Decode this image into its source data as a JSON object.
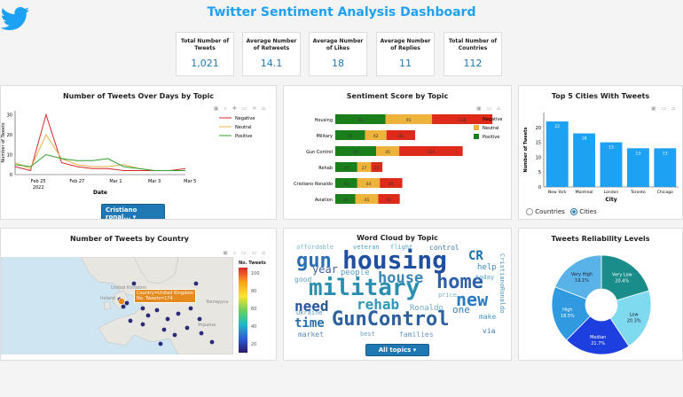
{
  "header": {
    "title": "Twitter Sentiment Analysis Dashboard",
    "logo_icon": "twitter-bird-icon",
    "brand_color": "#1da1f2"
  },
  "kpis": [
    {
      "label": "Total Number of Tweets",
      "value": "1,021"
    },
    {
      "label": "Average Number of Retweets",
      "value": "14.1"
    },
    {
      "label": "Average Number of Likes",
      "value": "18"
    },
    {
      "label": "Average Number of Replies",
      "value": "11"
    },
    {
      "label": "Total Number of Countries",
      "value": "112"
    }
  ],
  "line_panel": {
    "title": "Number of Tweets Over Days by Topic",
    "dropdown": "Cristiano ronal...",
    "chart_data": {
      "type": "line",
      "xlabel": "Date",
      "ylabel": "Number of Tweets",
      "x_ticks": [
        "Feb 25\n2022",
        "Feb 27",
        "Mar 1",
        "Mar 3",
        "Mar 5"
      ],
      "y_ticks": [
        "0",
        "10",
        "20",
        "30"
      ],
      "ylim": [
        0,
        32
      ],
      "x": [
        0,
        1,
        2,
        3,
        4,
        5,
        6,
        7,
        8,
        9,
        10,
        11
      ],
      "series": [
        {
          "name": "Negative",
          "color": "#d62728",
          "values": [
            4,
            2,
            30,
            6,
            4,
            3,
            3,
            2,
            2,
            2,
            2,
            3
          ]
        },
        {
          "name": "Neutral",
          "color": "#e4b04a",
          "values": [
            6,
            3,
            20,
            8,
            5,
            4,
            4,
            5,
            3,
            2,
            2,
            2
          ]
        },
        {
          "name": "Positive",
          "color": "#2ca02c",
          "values": [
            5,
            4,
            10,
            8,
            7,
            7,
            8,
            4,
            3,
            2,
            2,
            2
          ]
        }
      ]
    }
  },
  "sent_panel": {
    "title": "Sentiment Score by Topic",
    "chart_data": {
      "type": "bar",
      "orientation": "horizontal",
      "stacked": true,
      "categories": [
        "Housing",
        "Military",
        "Gun Control",
        "Rehab",
        "Cristiano Ronaldo",
        "Aviation"
      ],
      "series": [
        {
          "name": "Positive",
          "color": "#1a7f1a",
          "values": [
            98,
            58,
            80,
            43,
            43,
            39
          ]
        },
        {
          "name": "Neutral",
          "color": "#eeb33b",
          "values": [
            91,
            42,
            45,
            27,
            44,
            45
          ]
        },
        {
          "name": "Negative",
          "color": "#dd2a1a",
          "values": [
            118,
            56,
            124,
            22,
            44,
            42
          ]
        }
      ]
    }
  },
  "cities_panel": {
    "title": "Top 5 Cities With Tweets",
    "radio_options": [
      "Countries",
      "Cities"
    ],
    "radio_selected": "Cities",
    "chart_data": {
      "type": "bar",
      "categories": [
        "New York",
        "Montreal",
        "London",
        "Toronto",
        "Chicago"
      ],
      "values": [
        22,
        18,
        15,
        13,
        13
      ],
      "xlabel": "City",
      "ylabel": "Number of Tweets",
      "y_ticks": [
        "0",
        "5",
        "10",
        "15",
        "20"
      ],
      "ylim": [
        0,
        25
      ],
      "color": "#1da1f2"
    }
  },
  "map_panel": {
    "title": "Number of Tweets by Country",
    "colorbar_title": "No. Tweets",
    "colorbar_ticks": [
      "100",
      "80",
      "60",
      "40",
      "20"
    ],
    "tooltip_line1": "Country=United Kingdom",
    "tooltip_line2": "No. Tweets=174",
    "place_labels": [
      "United Kingdom",
      "Беларусь",
      "Україна",
      "Ireland"
    ]
  },
  "cloud_panel": {
    "title": "Word Cloud by Topic",
    "dropdown": "All topics",
    "words": [
      {
        "t": "gun",
        "c": "#2c6fb3"
      },
      {
        "t": "housing",
        "c": "#1f4f9e"
      },
      {
        "t": "military",
        "c": "#2a8fb0"
      },
      {
        "t": "home",
        "c": "#2e5fa8"
      },
      {
        "t": "GunControl",
        "c": "#2b5f9e"
      },
      {
        "t": "new",
        "c": "#2a7cc0"
      },
      {
        "t": "house",
        "c": "#3a87b5"
      },
      {
        "t": "need",
        "c": "#29579b"
      },
      {
        "t": "rehab",
        "c": "#3197b8"
      },
      {
        "t": "time",
        "c": "#2a6db0"
      },
      {
        "t": "CR",
        "c": "#1f6fa7"
      },
      {
        "t": "year",
        "c": "#3a5d9c"
      },
      {
        "t": "veteran",
        "c": "#4a9fc0"
      },
      {
        "t": "flight",
        "c": "#5aa8c8"
      },
      {
        "t": "control",
        "c": "#3f79a8"
      },
      {
        "t": "people",
        "c": "#55a0c8"
      },
      {
        "t": "help",
        "c": "#3b8ab9"
      },
      {
        "t": "Ronaldo",
        "c": "#6baac8"
      },
      {
        "t": "one",
        "c": "#397eb0"
      },
      {
        "t": "make",
        "c": "#4a95bd"
      },
      {
        "t": "Ukraine",
        "c": "#5d9ac4"
      },
      {
        "t": "market",
        "c": "#5c86b4"
      },
      {
        "t": "best",
        "c": "#6aa1c4"
      },
      {
        "t": "families",
        "c": "#6895bd"
      },
      {
        "t": "via",
        "c": "#3d7ab0"
      },
      {
        "t": "today",
        "c": "#5aa2c8"
      },
      {
        "t": "affordable",
        "c": "#7ab4cf"
      },
      {
        "t": "good",
        "c": "#5f9fc8"
      },
      {
        "t": "price",
        "c": "#7cb0ce"
      },
      {
        "t": "CristianoRonaldo",
        "c": "#4a92c0"
      }
    ]
  },
  "pie_panel": {
    "title": "Tweets Reliability Levels",
    "chart_data": {
      "type": "pie",
      "donut": true,
      "slices": [
        {
          "label": "Very Low",
          "value": 20.4,
          "color": "#1a8c8a"
        },
        {
          "label": "Low",
          "value": 20.3,
          "color": "#7fd9ef"
        },
        {
          "label": "Median",
          "value": 21.7,
          "color": "#1d3fe0"
        },
        {
          "label": "High",
          "value": 18.5,
          "color": "#2f9ae0"
        },
        {
          "label": "Very High",
          "value": 19.1,
          "color": "#5ab3e8"
        }
      ]
    }
  }
}
